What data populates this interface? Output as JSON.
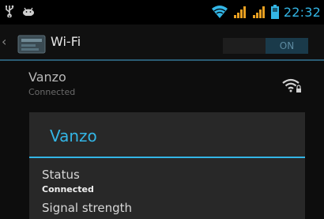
{
  "status_bar": {
    "time": "22:32",
    "icons": [
      "usb-icon",
      "android-debug-icon",
      "wifi-signal-icon",
      "cell-signal-icon",
      "cell-signal-icon",
      "battery-icon"
    ]
  },
  "action_bar": {
    "title": "Wi-Fi",
    "toggle_label": "ON",
    "icon": "wifi-settings-icon"
  },
  "network": {
    "name": "Vanzo",
    "status": "Connected",
    "icon": "wifi-locked-icon"
  },
  "dialog": {
    "title": "Vanzo",
    "fields": [
      {
        "label": "Status",
        "value": "Connected"
      },
      {
        "label": "Signal strength",
        "value": ""
      }
    ]
  },
  "colors": {
    "accent": "#33b5e5",
    "background": "#0d0d0d",
    "dialog": "#282828"
  }
}
